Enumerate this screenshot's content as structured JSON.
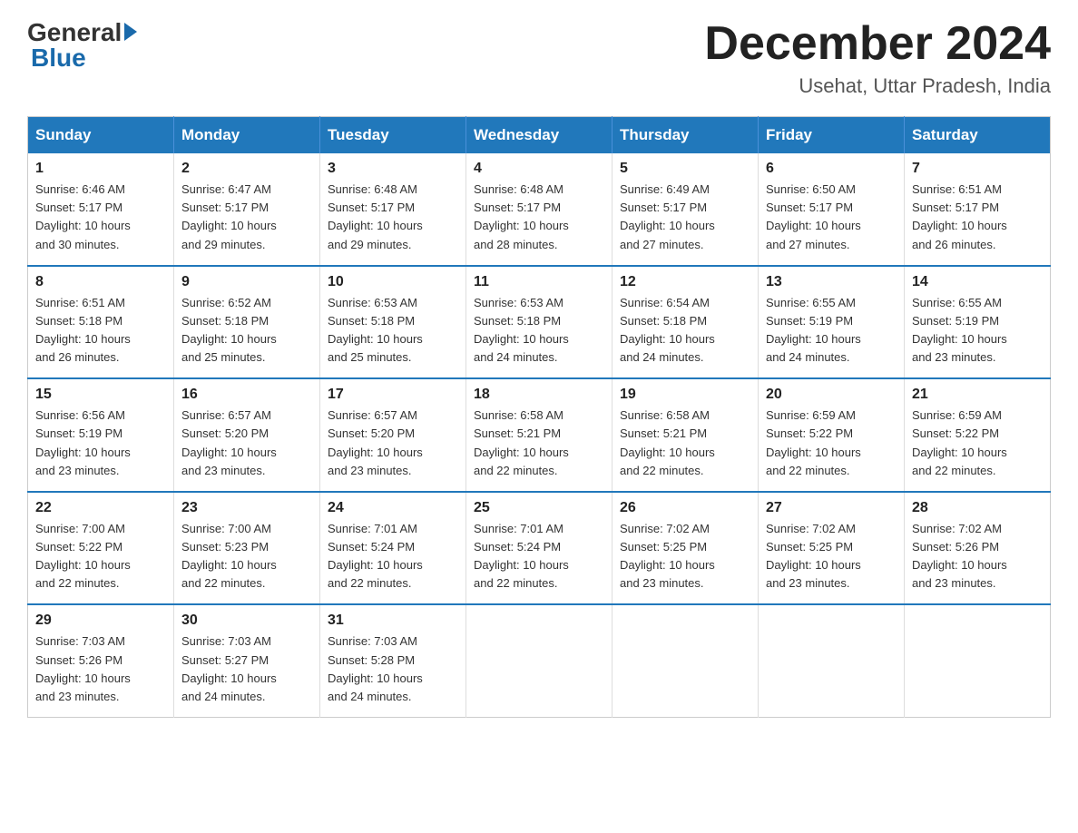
{
  "logo": {
    "general_text": "General",
    "blue_text": "Blue"
  },
  "header": {
    "month_year": "December 2024",
    "location": "Usehat, Uttar Pradesh, India"
  },
  "weekdays": [
    "Sunday",
    "Monday",
    "Tuesday",
    "Wednesday",
    "Thursday",
    "Friday",
    "Saturday"
  ],
  "weeks": [
    [
      {
        "day": "1",
        "info": "Sunrise: 6:46 AM\nSunset: 5:17 PM\nDaylight: 10 hours\nand 30 minutes."
      },
      {
        "day": "2",
        "info": "Sunrise: 6:47 AM\nSunset: 5:17 PM\nDaylight: 10 hours\nand 29 minutes."
      },
      {
        "day": "3",
        "info": "Sunrise: 6:48 AM\nSunset: 5:17 PM\nDaylight: 10 hours\nand 29 minutes."
      },
      {
        "day": "4",
        "info": "Sunrise: 6:48 AM\nSunset: 5:17 PM\nDaylight: 10 hours\nand 28 minutes."
      },
      {
        "day": "5",
        "info": "Sunrise: 6:49 AM\nSunset: 5:17 PM\nDaylight: 10 hours\nand 27 minutes."
      },
      {
        "day": "6",
        "info": "Sunrise: 6:50 AM\nSunset: 5:17 PM\nDaylight: 10 hours\nand 27 minutes."
      },
      {
        "day": "7",
        "info": "Sunrise: 6:51 AM\nSunset: 5:17 PM\nDaylight: 10 hours\nand 26 minutes."
      }
    ],
    [
      {
        "day": "8",
        "info": "Sunrise: 6:51 AM\nSunset: 5:18 PM\nDaylight: 10 hours\nand 26 minutes."
      },
      {
        "day": "9",
        "info": "Sunrise: 6:52 AM\nSunset: 5:18 PM\nDaylight: 10 hours\nand 25 minutes."
      },
      {
        "day": "10",
        "info": "Sunrise: 6:53 AM\nSunset: 5:18 PM\nDaylight: 10 hours\nand 25 minutes."
      },
      {
        "day": "11",
        "info": "Sunrise: 6:53 AM\nSunset: 5:18 PM\nDaylight: 10 hours\nand 24 minutes."
      },
      {
        "day": "12",
        "info": "Sunrise: 6:54 AM\nSunset: 5:18 PM\nDaylight: 10 hours\nand 24 minutes."
      },
      {
        "day": "13",
        "info": "Sunrise: 6:55 AM\nSunset: 5:19 PM\nDaylight: 10 hours\nand 24 minutes."
      },
      {
        "day": "14",
        "info": "Sunrise: 6:55 AM\nSunset: 5:19 PM\nDaylight: 10 hours\nand 23 minutes."
      }
    ],
    [
      {
        "day": "15",
        "info": "Sunrise: 6:56 AM\nSunset: 5:19 PM\nDaylight: 10 hours\nand 23 minutes."
      },
      {
        "day": "16",
        "info": "Sunrise: 6:57 AM\nSunset: 5:20 PM\nDaylight: 10 hours\nand 23 minutes."
      },
      {
        "day": "17",
        "info": "Sunrise: 6:57 AM\nSunset: 5:20 PM\nDaylight: 10 hours\nand 23 minutes."
      },
      {
        "day": "18",
        "info": "Sunrise: 6:58 AM\nSunset: 5:21 PM\nDaylight: 10 hours\nand 22 minutes."
      },
      {
        "day": "19",
        "info": "Sunrise: 6:58 AM\nSunset: 5:21 PM\nDaylight: 10 hours\nand 22 minutes."
      },
      {
        "day": "20",
        "info": "Sunrise: 6:59 AM\nSunset: 5:22 PM\nDaylight: 10 hours\nand 22 minutes."
      },
      {
        "day": "21",
        "info": "Sunrise: 6:59 AM\nSunset: 5:22 PM\nDaylight: 10 hours\nand 22 minutes."
      }
    ],
    [
      {
        "day": "22",
        "info": "Sunrise: 7:00 AM\nSunset: 5:22 PM\nDaylight: 10 hours\nand 22 minutes."
      },
      {
        "day": "23",
        "info": "Sunrise: 7:00 AM\nSunset: 5:23 PM\nDaylight: 10 hours\nand 22 minutes."
      },
      {
        "day": "24",
        "info": "Sunrise: 7:01 AM\nSunset: 5:24 PM\nDaylight: 10 hours\nand 22 minutes."
      },
      {
        "day": "25",
        "info": "Sunrise: 7:01 AM\nSunset: 5:24 PM\nDaylight: 10 hours\nand 22 minutes."
      },
      {
        "day": "26",
        "info": "Sunrise: 7:02 AM\nSunset: 5:25 PM\nDaylight: 10 hours\nand 23 minutes."
      },
      {
        "day": "27",
        "info": "Sunrise: 7:02 AM\nSunset: 5:25 PM\nDaylight: 10 hours\nand 23 minutes."
      },
      {
        "day": "28",
        "info": "Sunrise: 7:02 AM\nSunset: 5:26 PM\nDaylight: 10 hours\nand 23 minutes."
      }
    ],
    [
      {
        "day": "29",
        "info": "Sunrise: 7:03 AM\nSunset: 5:26 PM\nDaylight: 10 hours\nand 23 minutes."
      },
      {
        "day": "30",
        "info": "Sunrise: 7:03 AM\nSunset: 5:27 PM\nDaylight: 10 hours\nand 24 minutes."
      },
      {
        "day": "31",
        "info": "Sunrise: 7:03 AM\nSunset: 5:28 PM\nDaylight: 10 hours\nand 24 minutes."
      },
      {
        "day": "",
        "info": ""
      },
      {
        "day": "",
        "info": ""
      },
      {
        "day": "",
        "info": ""
      },
      {
        "day": "",
        "info": ""
      }
    ]
  ]
}
